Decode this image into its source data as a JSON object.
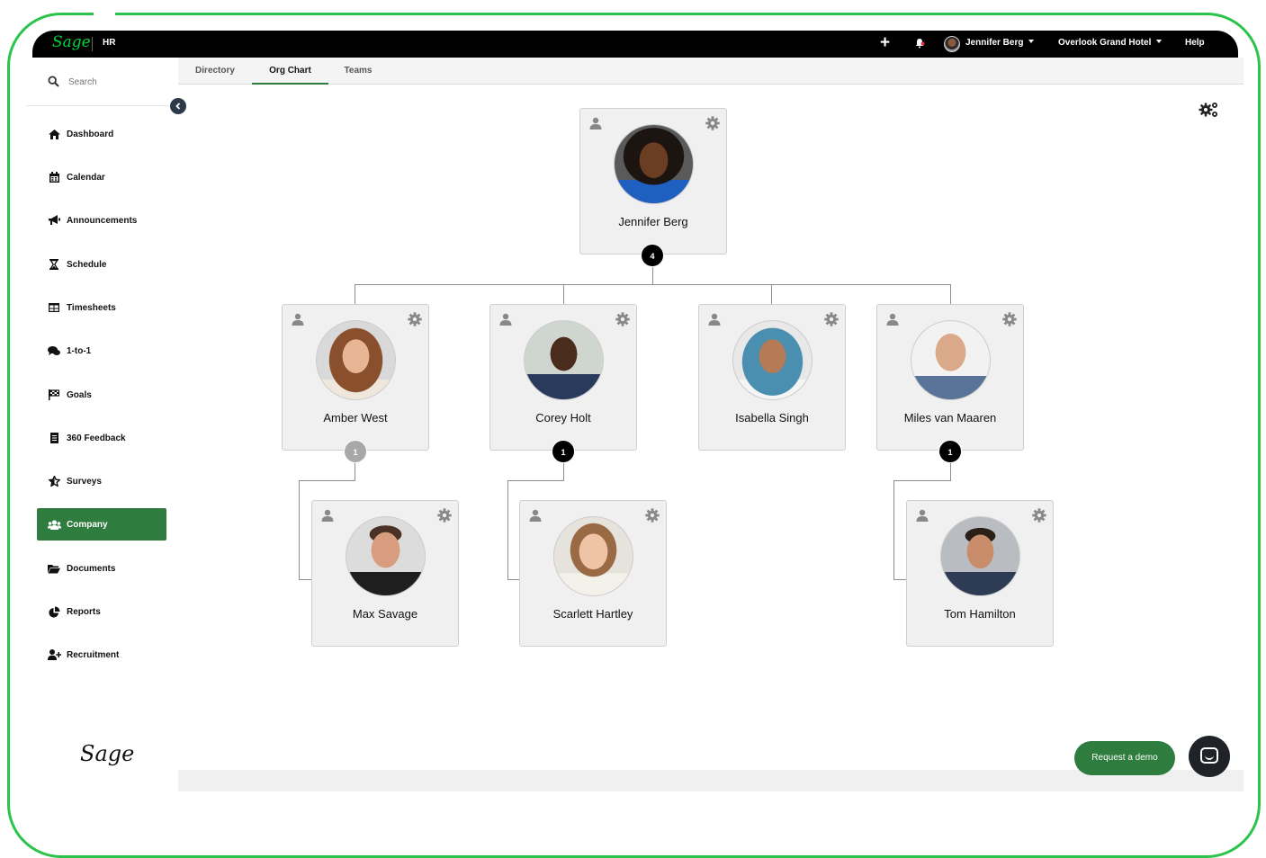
{
  "app": {
    "brand": "Sage",
    "module": "HR"
  },
  "topbar": {
    "add_label": "+",
    "user_name": "Jennifer Berg",
    "company": "Overlook Grand Hotel",
    "help": "Help"
  },
  "sidebar": {
    "search_placeholder": "Search",
    "items": [
      {
        "label": "Dashboard",
        "icon": "home-icon"
      },
      {
        "label": "Calendar",
        "icon": "calendar-icon"
      },
      {
        "label": "Announcements",
        "icon": "megaphone-icon"
      },
      {
        "label": "Schedule",
        "icon": "hourglass-icon"
      },
      {
        "label": "Timesheets",
        "icon": "table-icon"
      },
      {
        "label": "1-to-1",
        "icon": "chat-icon"
      },
      {
        "label": "Goals",
        "icon": "flag-icon"
      },
      {
        "label": "360 Feedback",
        "icon": "document-icon"
      },
      {
        "label": "Surveys",
        "icon": "star-icon"
      },
      {
        "label": "Company",
        "icon": "users-icon",
        "active": true
      },
      {
        "label": "Documents",
        "icon": "folder-icon"
      },
      {
        "label": "Reports",
        "icon": "pie-chart-icon"
      },
      {
        "label": "Recruitment",
        "icon": "user-plus-icon"
      }
    ],
    "footer_logo": "Sage"
  },
  "tabs": [
    {
      "label": "Directory"
    },
    {
      "label": "Org Chart",
      "active": true
    },
    {
      "label": "Teams"
    }
  ],
  "org_chart": {
    "root": {
      "name": "Jennifer Berg",
      "reports": "4"
    },
    "level1": [
      {
        "name": "Amber West",
        "reports": "1"
      },
      {
        "name": "Corey Holt",
        "reports": "1"
      },
      {
        "name": "Isabella Singh"
      },
      {
        "name": "Miles van Maaren",
        "reports": "1"
      }
    ],
    "level2": [
      {
        "name": "Max Savage"
      },
      {
        "name": "Scarlett Hartley"
      },
      {
        "name": "Tom Hamilton"
      }
    ]
  },
  "actions": {
    "request_demo": "Request a demo"
  },
  "colors": {
    "accent": "#2f7d3e",
    "brand_green": "#00d639",
    "frame": "#2bc34a"
  }
}
